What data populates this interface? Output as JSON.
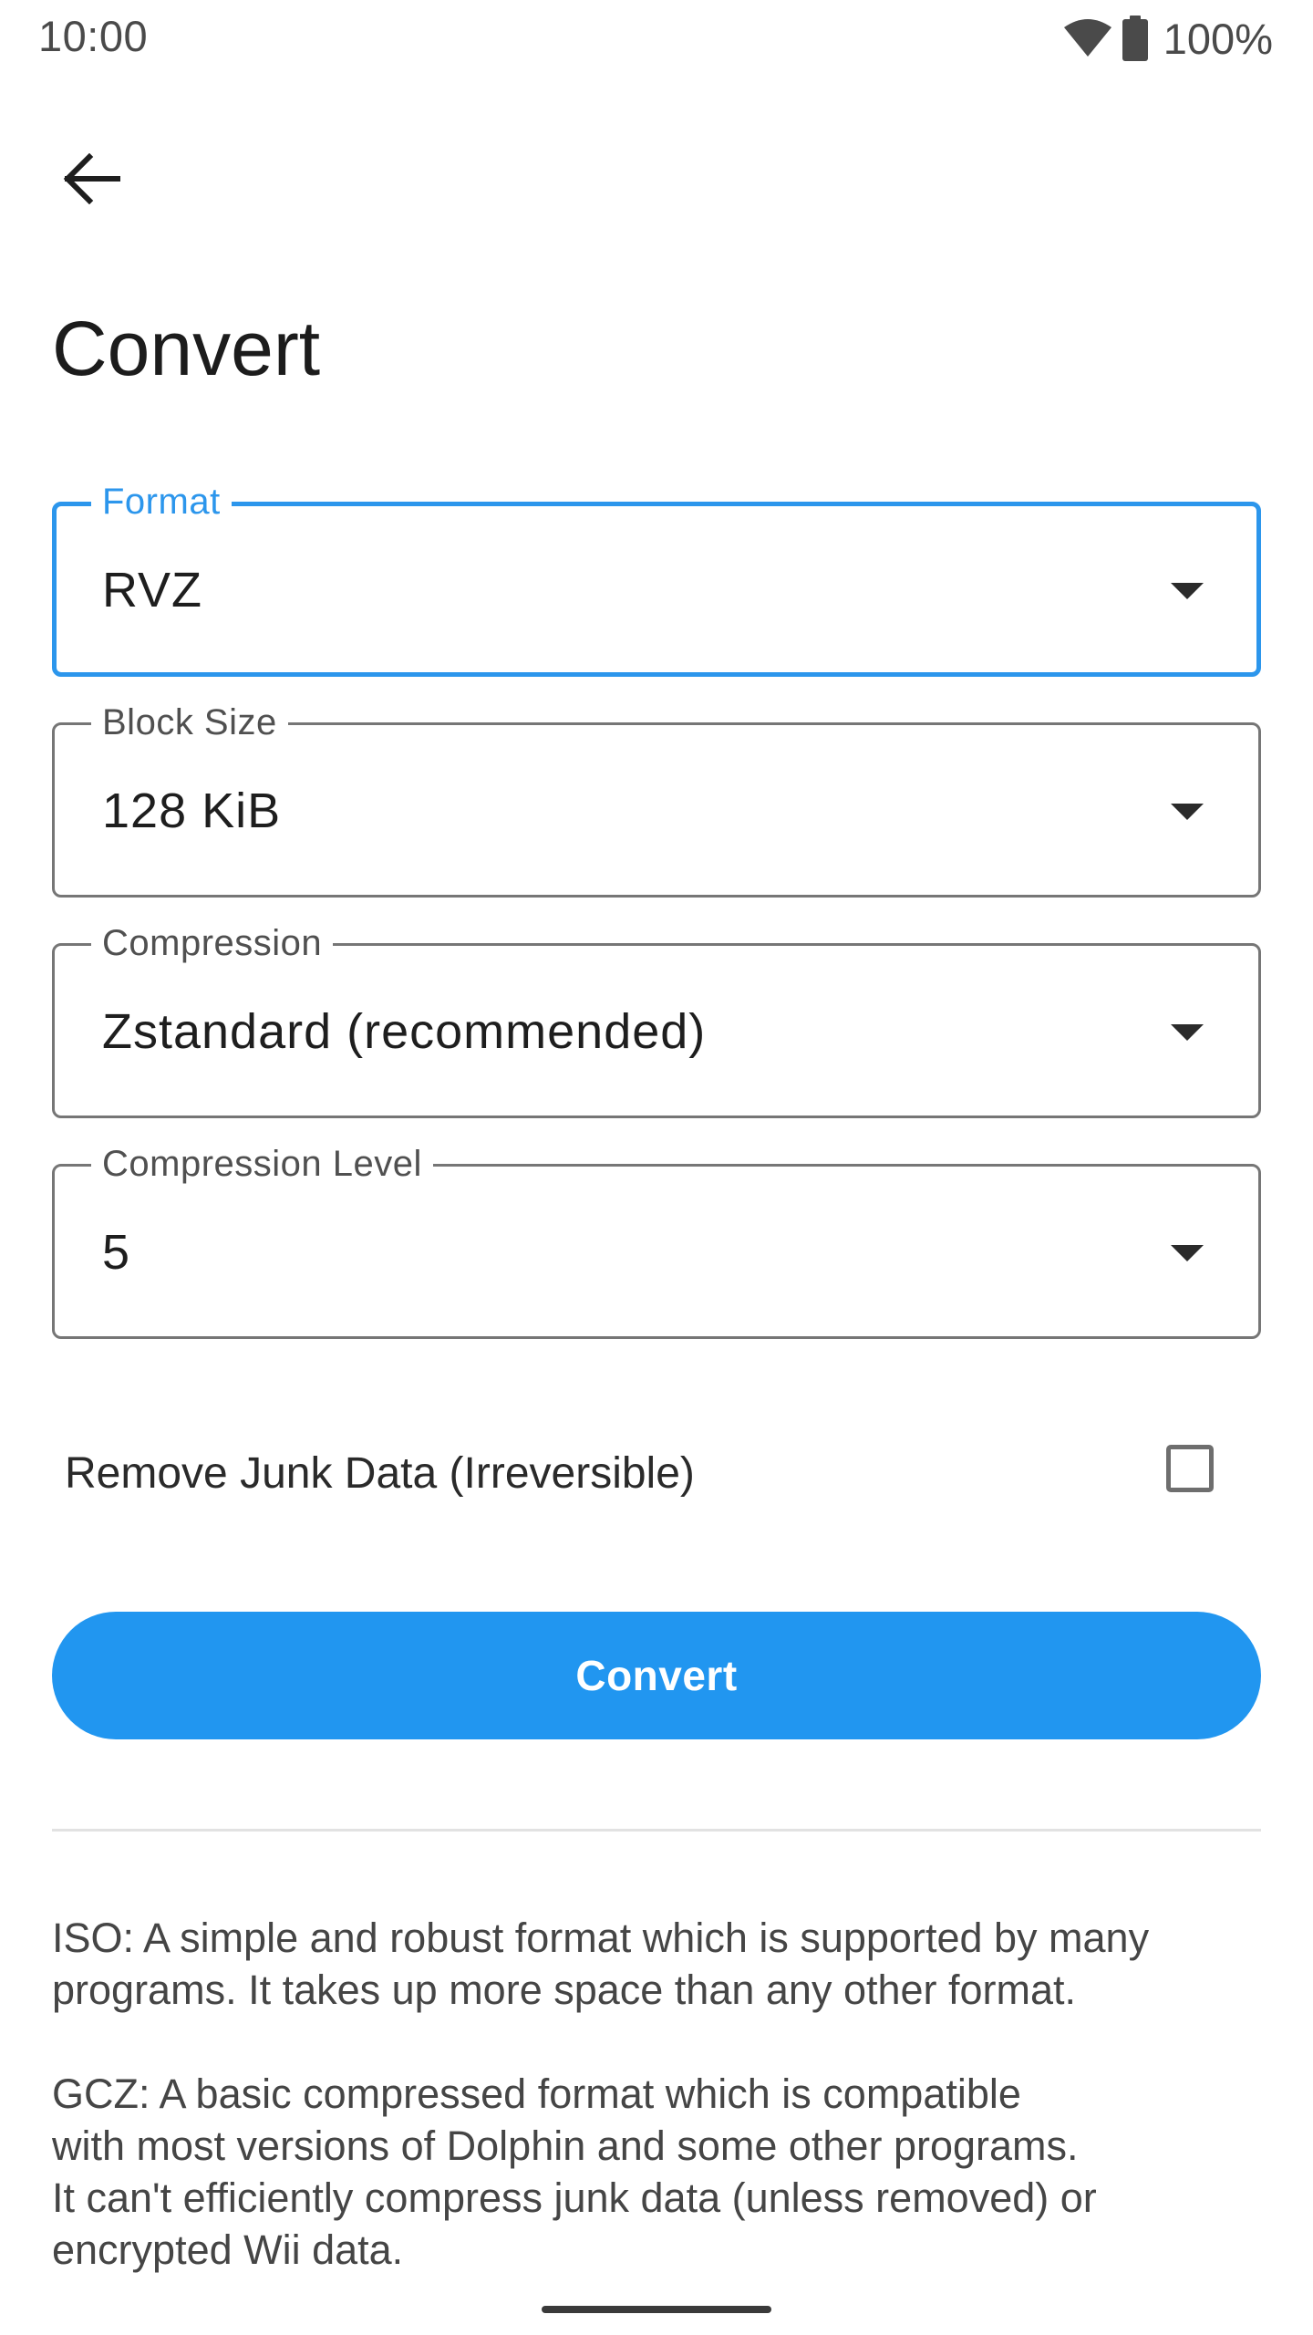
{
  "status_bar": {
    "time": "10:00",
    "battery_percent": "100%",
    "icons": [
      "wifi-icon",
      "battery-icon"
    ]
  },
  "header": {
    "back_icon": "arrow-back-icon",
    "title": "Convert"
  },
  "form": {
    "format": {
      "label": "Format",
      "value": "RVZ",
      "focused": true
    },
    "block_size": {
      "label": "Block Size",
      "value": "128 KiB"
    },
    "compression": {
      "label": "Compression",
      "value": "Zstandard (recommended)"
    },
    "compression_level": {
      "label": "Compression Level",
      "value": "5"
    },
    "remove_junk": {
      "label": "Remove Junk Data (Irreversible)",
      "checked": false
    }
  },
  "convert_button": {
    "label": "Convert"
  },
  "description": {
    "iso": "ISO: A simple and robust format which is supported by many\nprograms. It takes up more space than any other format.",
    "gcz": "GCZ: A basic compressed format which is compatible\nwith most versions of Dolphin and some other programs.\nIt can't efficiently compress junk data (unless removed) or\nencrypted Wii data."
  },
  "colors": {
    "accent": "#2196F0",
    "focused_outline": "#2C96EC",
    "outline": "#767676",
    "background": "#FFFFFF"
  }
}
